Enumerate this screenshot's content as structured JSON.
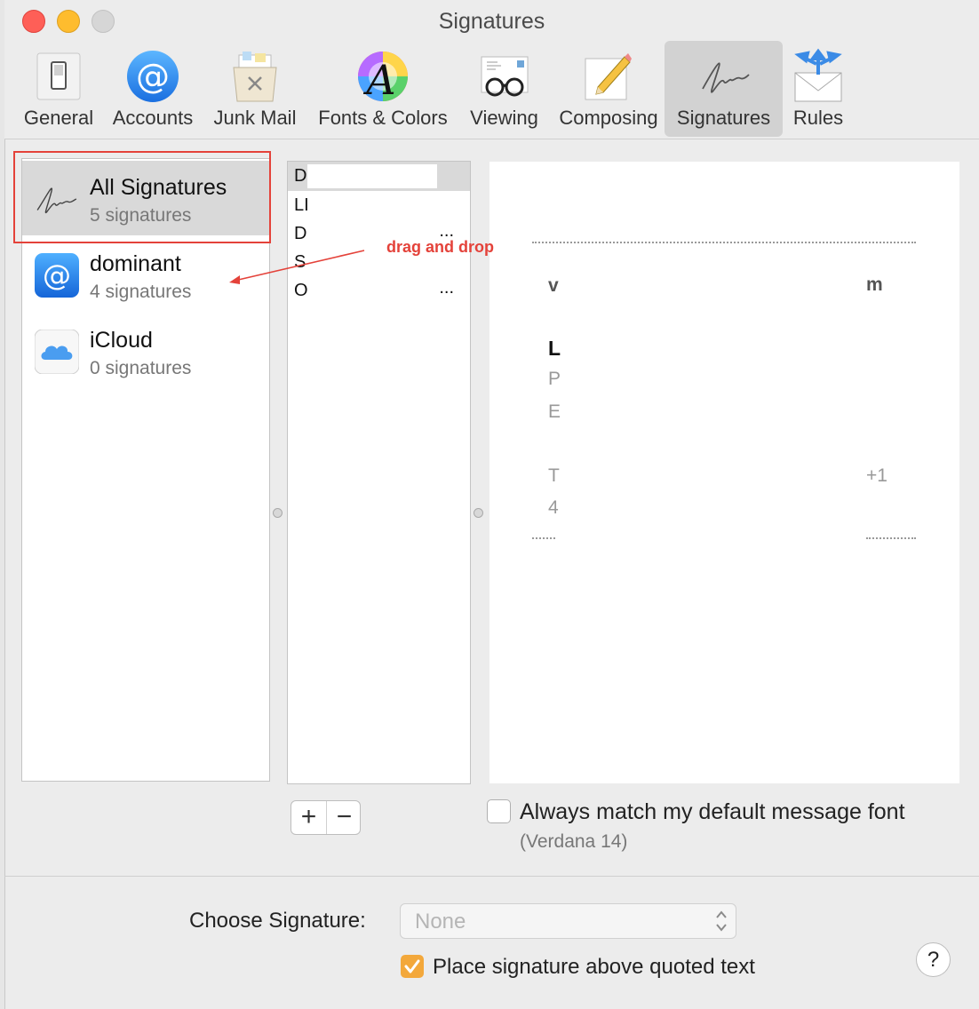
{
  "window": {
    "title": "Signatures"
  },
  "toolbar": {
    "tabs": [
      {
        "label": "General",
        "icon": "general-switch-icon"
      },
      {
        "label": "Accounts",
        "icon": "at-sign-icon"
      },
      {
        "label": "Junk Mail",
        "icon": "junk-bin-icon"
      },
      {
        "label": "Fonts & Colors",
        "icon": "font-color-wheel-icon"
      },
      {
        "label": "Viewing",
        "icon": "glasses-icon"
      },
      {
        "label": "Composing",
        "icon": "pencil-paper-icon"
      },
      {
        "label": "Signatures",
        "icon": "signature-icon",
        "active": true
      },
      {
        "label": "Rules",
        "icon": "rules-envelope-icon"
      }
    ]
  },
  "accounts": [
    {
      "name": "All Signatures",
      "count": "5 signatures",
      "icon": "signature-icon",
      "selected": true
    },
    {
      "name": "dominant",
      "count": "4 signatures",
      "icon": "at-sign-icon"
    },
    {
      "name": "iCloud",
      "count": "0 signatures",
      "icon": "icloud-icon"
    }
  ],
  "signatures": [
    {
      "initial": "D",
      "ellipsis": ""
    },
    {
      "initial": "LI",
      "ellipsis": ""
    },
    {
      "initial": "D",
      "ellipsis": "..."
    },
    {
      "initial": "S",
      "ellipsis": ""
    },
    {
      "initial": "O",
      "ellipsis": "..."
    }
  ],
  "preview": {
    "left_column": [
      "v",
      "L",
      "P",
      "E",
      "T",
      "4"
    ],
    "right_column": [
      "m",
      "+1"
    ]
  },
  "annotation": {
    "text": "drag and drop",
    "color": "#e4423a"
  },
  "buttons": {
    "add": "+",
    "remove": "−",
    "help": "?"
  },
  "options": {
    "match_font_label": "Always match my default message font",
    "match_font_sub": "(Verdana 14)",
    "match_font_checked": false,
    "choose_signature_label": "Choose Signature:",
    "choose_signature_value": "None",
    "place_above_label": "Place signature above quoted text",
    "place_above_checked": true
  },
  "colors": {
    "accent_checkbox": "#f3a83b",
    "selection": "#d9d9d9"
  }
}
